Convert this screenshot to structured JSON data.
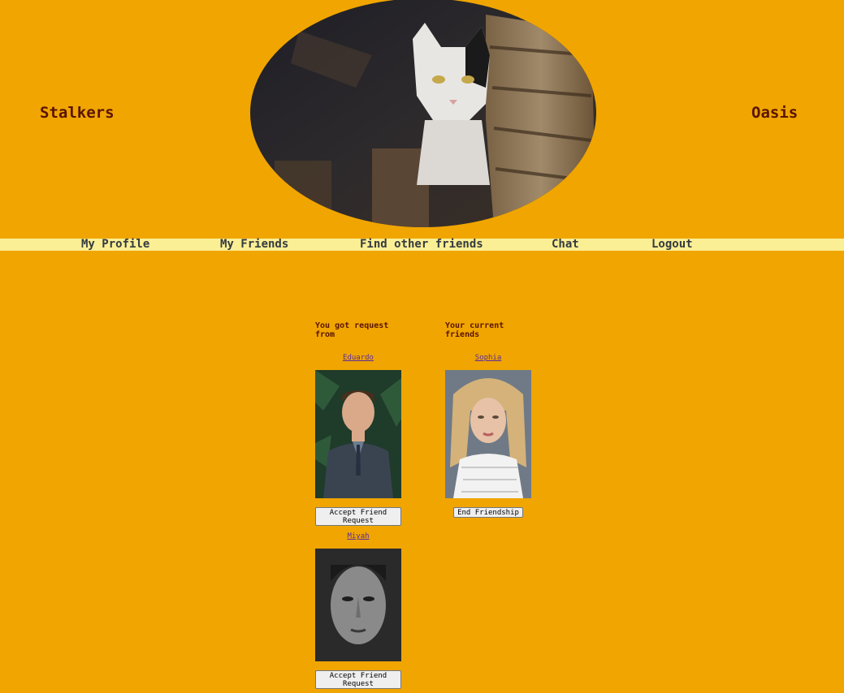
{
  "header": {
    "left_title": "Stalkers",
    "right_title": "Oasis",
    "banner_image": "cat-peeking-from-wooden-boards"
  },
  "nav": {
    "items": [
      "My Profile",
      "My Friends",
      "Find other friends",
      "Chat",
      "Logout"
    ]
  },
  "requests": {
    "heading": "You got request from",
    "items": [
      {
        "name": "Eduardo",
        "photo": "young-man-in-suit-portrait",
        "button": "Accept Friend Request"
      },
      {
        "name": "Miyah",
        "photo": "dark-woman-face-portrait",
        "button": "Accept Friend Request"
      }
    ]
  },
  "friends": {
    "heading": "Your current friends",
    "items": [
      {
        "name": "Sophia",
        "photo": "blonde-woman-wet-hair-portrait",
        "button": "End Friendship"
      }
    ]
  },
  "colors": {
    "background": "#f0a500",
    "navbar": "#fbef95",
    "title_text": "#5a1400",
    "link": "#5b2ca0"
  }
}
